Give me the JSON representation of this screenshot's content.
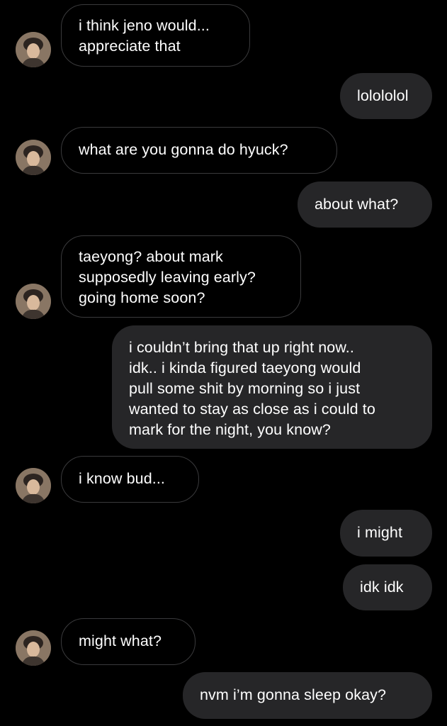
{
  "messages": [
    {
      "sender": "them",
      "text": "i think jeno would...\nappreciate that"
    },
    {
      "sender": "me",
      "text": "lolololol"
    },
    {
      "sender": "them",
      "text": "what are you gonna do hyuck?"
    },
    {
      "sender": "me",
      "text": "about what?"
    },
    {
      "sender": "them",
      "text": "taeyong? about mark\nsupposedly leaving early?\ngoing home soon?"
    },
    {
      "sender": "me",
      "text": "i couldn’t bring that up right now..\nidk.. i kinda figured taeyong would\npull some shit by morning so i just\nwanted to stay as close as i could to\nmark for the night, you know?"
    },
    {
      "sender": "them",
      "text": "i know bud..."
    },
    {
      "sender": "me",
      "text": "i might"
    },
    {
      "sender": "me",
      "text": "idk idk"
    },
    {
      "sender": "them",
      "text": "might what?"
    },
    {
      "sender": "me",
      "text": "nvm i’m gonna sleep okay?"
    }
  ],
  "colors": {
    "background": "#000000",
    "incoming_border": "#3a3a3c",
    "outgoing_fill": "#262628",
    "text": "#ffffff"
  },
  "icons": {
    "contact_avatar": "profile-photo"
  }
}
